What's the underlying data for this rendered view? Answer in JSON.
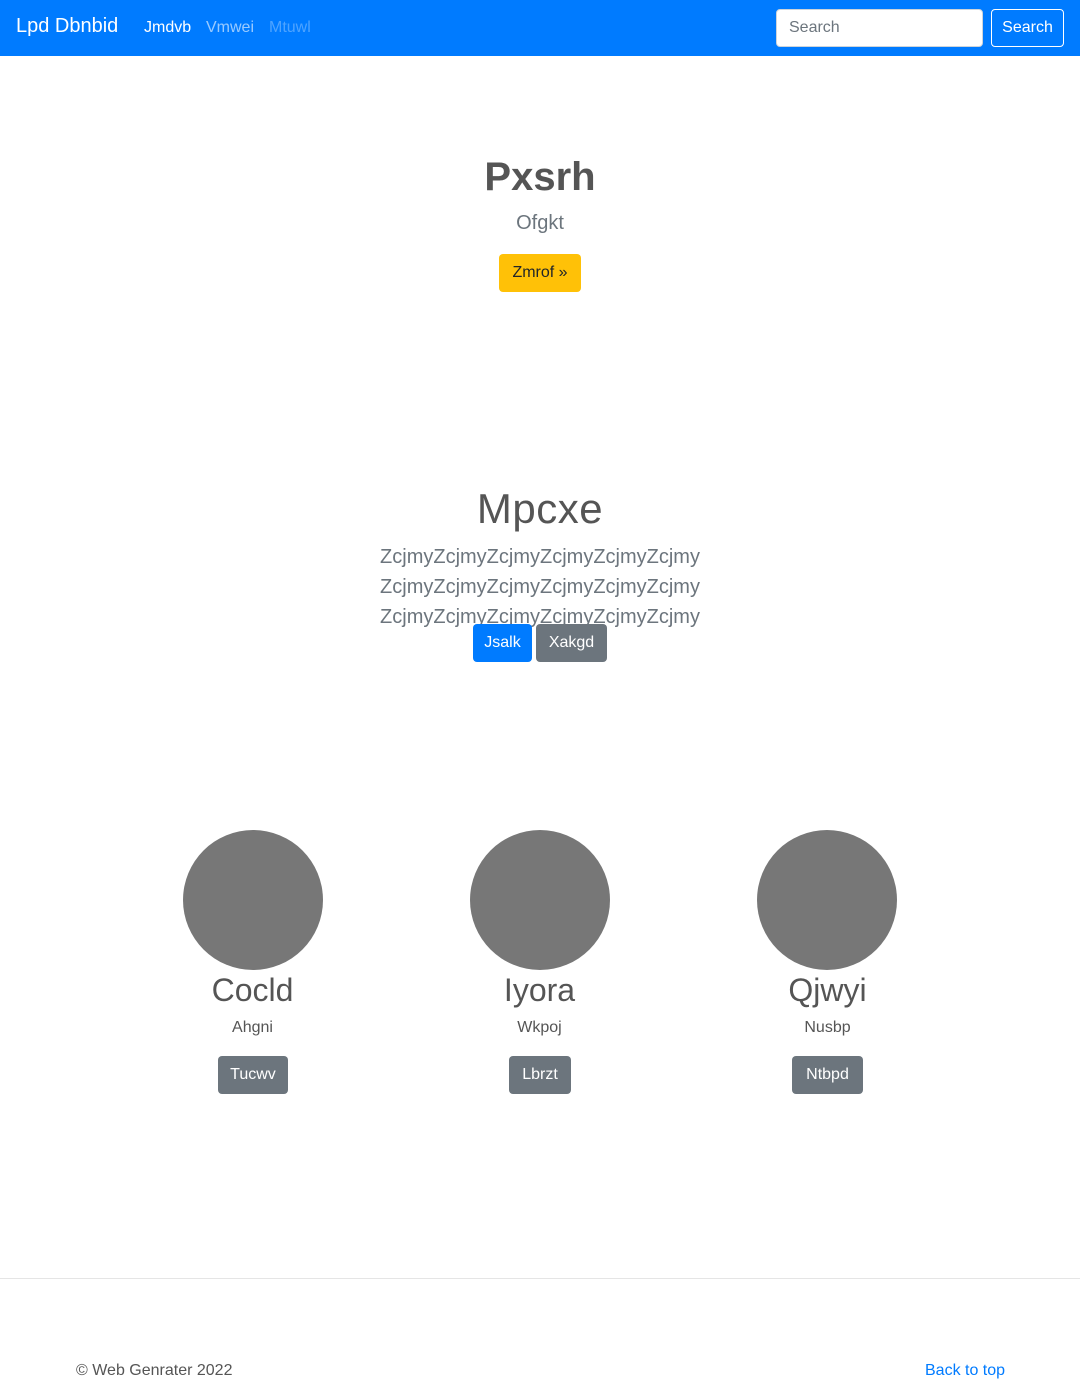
{
  "navbar": {
    "brand": "Lpd Dbnbid",
    "links": [
      {
        "label": "Jmdvb"
      },
      {
        "label": "Vmwei"
      },
      {
        "label": "Mtuwl"
      }
    ],
    "search_placeholder": "Search",
    "search_button": "Search",
    "background_color": "#007bff"
  },
  "hero": {
    "title": "Pxsrh",
    "subtitle": "Ofgkt",
    "button_label": "Zmrof »"
  },
  "jumbotron": {
    "title": "Mpcxe",
    "text": "ZcjmyZcjmyZcjmyZcjmyZcjmyZcjmy ZcjmyZcjmyZcjmyZcjmyZcjmyZcjmy ZcjmyZcjmyZcjmyZcjmyZcjmyZcjmy",
    "primary_button": "Jsalk",
    "secondary_button": "Xakgd"
  },
  "columns": [
    {
      "title": "Cocld",
      "text": "Ahgni",
      "button": "Tucwv"
    },
    {
      "title": "Iyora",
      "text": "Wkpoj",
      "button": "Lbrzt"
    },
    {
      "title": "Qjwyi",
      "text": "Nusbp",
      "button": "Ntbpd"
    }
  ],
  "footer": {
    "copyright": "© Web Genrater 2022",
    "back_to_top": "Back to top"
  }
}
